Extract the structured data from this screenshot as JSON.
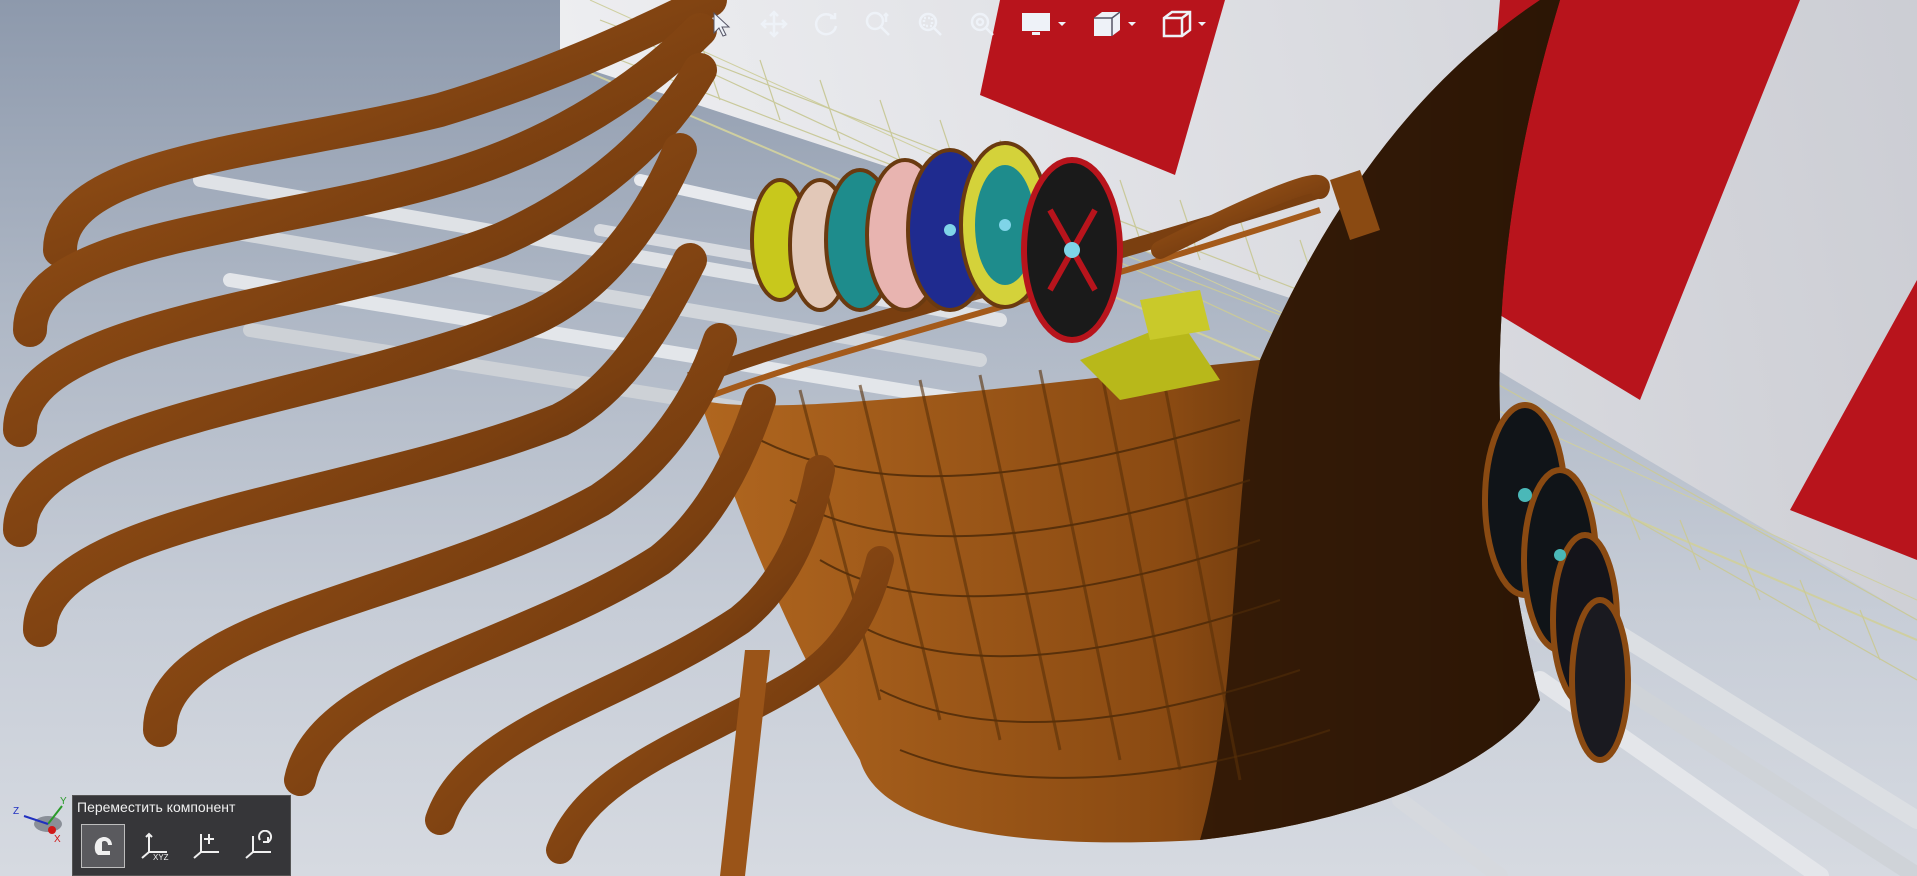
{
  "app": {
    "viewport_label": "3D model viewport"
  },
  "toolbar": {
    "tools": [
      {
        "name": "select-tool",
        "icon": "cursor-icon"
      },
      {
        "name": "pan-tool",
        "icon": "move-arrows-icon"
      },
      {
        "name": "rotate-tool",
        "icon": "rotate-icon"
      },
      {
        "name": "zoom-tool",
        "icon": "zoom-icon"
      },
      {
        "name": "zoom-window-tool",
        "icon": "zoom-window-icon"
      },
      {
        "name": "zoom-fit-tool",
        "icon": "zoom-fit-icon"
      },
      {
        "name": "display-mode-dropdown",
        "icon": "monitor-icon"
      },
      {
        "name": "section-view-dropdown",
        "icon": "section-view-icon"
      },
      {
        "name": "view-orientation-dropdown",
        "icon": "cube-icon"
      }
    ]
  },
  "triad": {
    "x_label": "X",
    "y_label": "Y",
    "z_label": "Z"
  },
  "move_panel": {
    "title": "Переместить компонент",
    "buttons": [
      {
        "name": "free-drag-button",
        "icon": "hand-drag-icon",
        "sub": "",
        "active": true
      },
      {
        "name": "move-xyz-button",
        "icon": "xyz-axes-icon",
        "sub": "XYZ",
        "active": false
      },
      {
        "name": "move-delta-button",
        "icon": "axes-delta-icon",
        "sub": "",
        "active": false
      },
      {
        "name": "rotate-component-button",
        "icon": "axes-rotate-icon",
        "sub": "",
        "active": false
      }
    ]
  },
  "colors": {
    "wood": "#8a4a12",
    "wood_dark": "#3a1e08",
    "sail_red": "#b8141c",
    "sail_white": "#e8e8ec",
    "shield_blue": "#1f2b8f",
    "shield_yellow": "#c8c81c",
    "shield_teal": "#1e8c8c",
    "panel_bg": "#28282a"
  }
}
